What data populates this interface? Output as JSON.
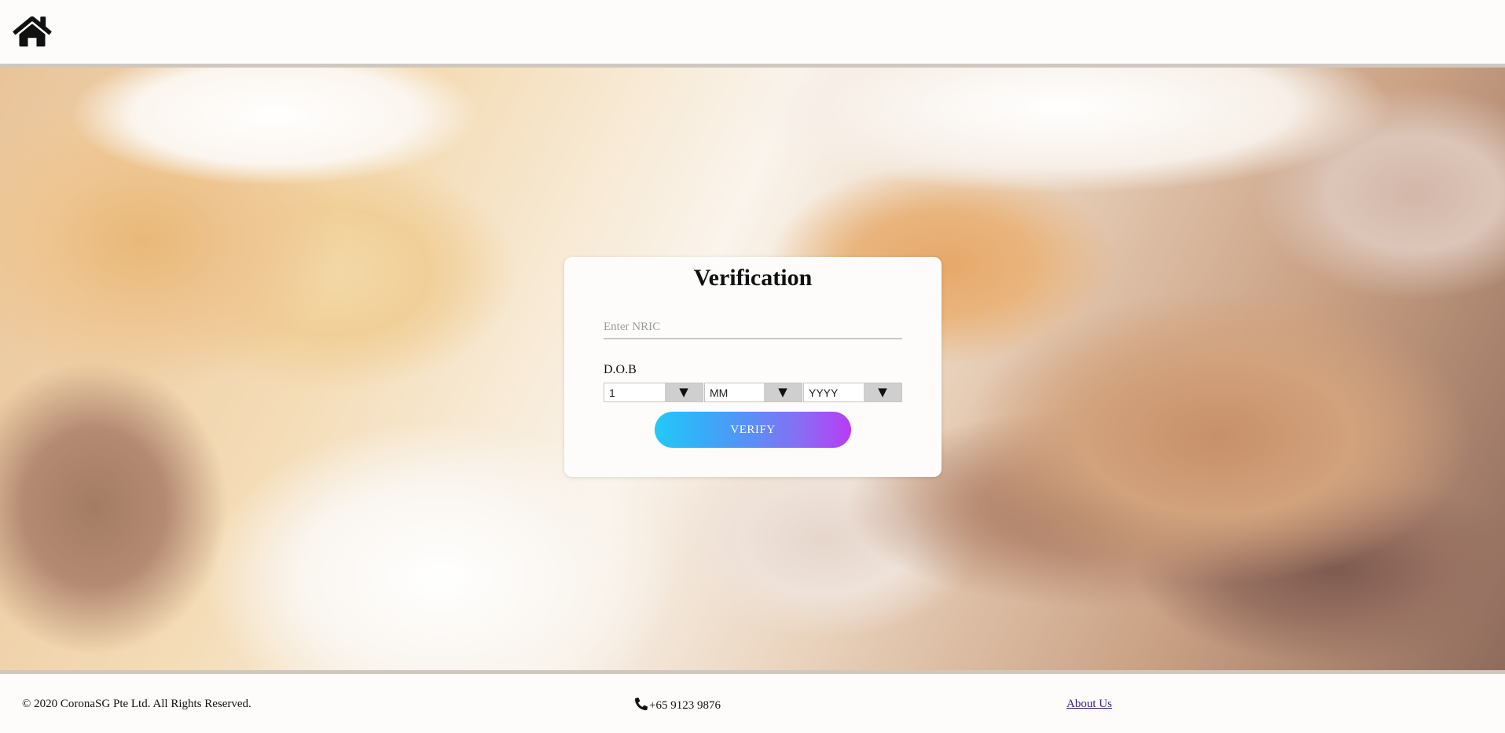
{
  "header": {
    "home_icon": "home-icon"
  },
  "card": {
    "title": "Verification",
    "nric_placeholder": "Enter NRIC",
    "nric_value": "",
    "dob_label": "D.O.B",
    "day_value": "1",
    "month_value": "MM",
    "year_value": "YYYY",
    "dropdown_arrow": "▼",
    "verify_label": "VERIFY"
  },
  "footer": {
    "copyright": "© 2020 CoronaSG Pte Ltd. All Rights Reserved.",
    "phone": "+65 9123 9876",
    "about_label": "About Us"
  },
  "colors": {
    "button_gradient_start": "#23c9f9",
    "button_gradient_end": "#b83cf6",
    "link": "#3a1f7a"
  }
}
